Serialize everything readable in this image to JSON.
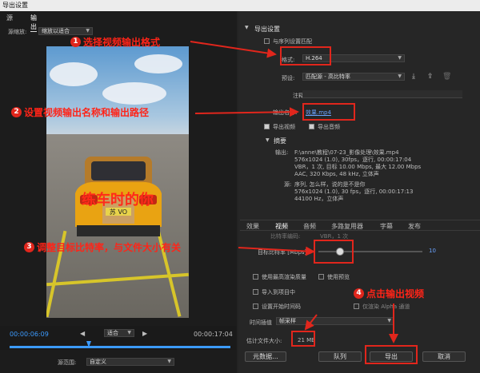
{
  "window": {
    "title": "导出设置"
  },
  "left": {
    "tabs": [
      "源",
      "输出"
    ],
    "scale_label": "源缩放:",
    "scale_value": "缩放以适合",
    "timecode_start": "00:00:06:09",
    "timecode_end": "00:00:17:04",
    "fit_value": "适合",
    "source_range_label": "源范围:",
    "source_range_value": "自定义",
    "video_caption": "练车时的你",
    "plate_text": "苏 VO"
  },
  "right": {
    "section_title": "导出设置",
    "match_sequence_label": "与序列设置匹配",
    "format_label": "格式:",
    "format_value": "H.264",
    "preset_label": "预设:",
    "preset_value": "匹配源 - 高比特率",
    "comment_label": "注释:",
    "output_name_label": "输出名称:",
    "output_name_value": "效果.mp4",
    "export_video_label": "导出视频",
    "export_audio_label": "导出音频",
    "summary_title": "摘要",
    "output_label": "输出:",
    "output_lines": [
      "F:\\anne\\教程\\07-23_影像处理\\效果.mp4",
      "576x1024 (1.0), 30fps，逐行, 00:00:17:04",
      "VBR，1 次, 目标 10.00 Mbps, 最大 12.00 Mbps",
      "AAC, 320 Kbps, 48 kHz, 立体声"
    ],
    "source_label": "源:",
    "source_lines": [
      "序列, 怎么样，说的是不是你",
      "576x1024 (1.0), 30 fps，逐行, 00:00:17:13",
      "44100 Hz，立体声"
    ],
    "sub_tabs": [
      "效果",
      "视频",
      "音频",
      "多路复用器",
      "字幕",
      "发布"
    ],
    "cutoff_row_label": "比特率编码:",
    "cutoff_row_value": "VBR，1 次",
    "target_bitrate_label": "目标比特率 [Mbps]:",
    "target_bitrate_value": "10",
    "max_render_quality_label": "使用最高渲染质量",
    "use_preview_label": "使用预览",
    "import_project_label": "导入到项目中",
    "set_start_timecode_label": "设置开始时间码",
    "render_alpha_label": "仅渲染 Alpha 通道",
    "time_interp_label": "时间插值",
    "time_interp_value": "帧采样",
    "est_file_size_label": "估计文件大小:",
    "est_file_size_value": "21 MB",
    "metadata_button": "元数据...",
    "queue_button": "队列",
    "export_button": "导出",
    "cancel_button": "取消"
  },
  "annotations": {
    "step1": {
      "num": "1",
      "text": "选择视频输出格式"
    },
    "step2": {
      "num": "2",
      "text": "设置视频输出名称和输出路径"
    },
    "step3": {
      "num": "3",
      "text": "调整目标比特率，与文件大小有关"
    },
    "step4": {
      "num": "4",
      "text": "点击输出视频"
    }
  },
  "colors": {
    "annotation_red": "#e1261c",
    "link_blue": "#6aa3ff",
    "timecode_blue": "#3c9bff"
  }
}
